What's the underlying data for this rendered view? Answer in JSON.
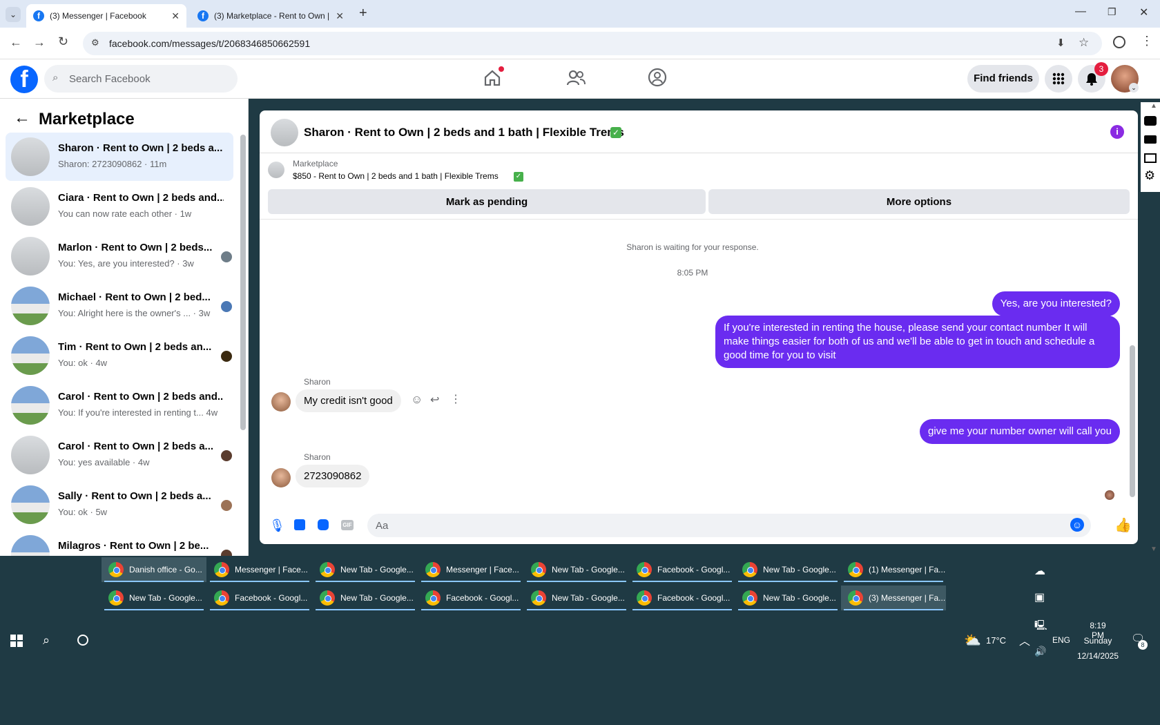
{
  "browser": {
    "tabs": [
      {
        "title": "(3) Messenger | Facebook",
        "active": true
      },
      {
        "title": "(3) Marketplace - Rent to Own |",
        "active": false
      }
    ],
    "new_tab": "+",
    "url": "facebook.com/messages/t/2068346850662591",
    "window_controls": [
      "minimize-icon",
      "restore-icon",
      "close-icon"
    ]
  },
  "facebook": {
    "search_placeholder": "Search Facebook",
    "find_friends": "Find friends",
    "notification_count": "3"
  },
  "sidebar": {
    "title": "Marketplace",
    "conversations": [
      {
        "title": "Sharon · Rent to Own | 2 beds a...",
        "sub": "Sharon: 2723090862 · 11m",
        "thumb": "room"
      },
      {
        "title": "Ciara · Rent to Own | 2 beds and...",
        "sub": "You can now rate each other · 1w",
        "thumb": "room"
      },
      {
        "title": "Marlon · Rent to Own | 2 beds...",
        "sub": "You: Yes, are you interested? · 3w",
        "thumb": "room"
      },
      {
        "title": "Michael · Rent to Own | 2 bed...",
        "sub": "You: Alright here is the owner's ... · 3w",
        "thumb": "house"
      },
      {
        "title": "Tim · Rent to Own | 2 beds an...",
        "sub": "You: ok · 4w",
        "thumb": "house"
      },
      {
        "title": "Carol · Rent to Own | 2 beds and...",
        "sub": "You: If you're interested in renting t... 4w",
        "thumb": "house"
      },
      {
        "title": "Carol · Rent to Own | 2 beds a...",
        "sub": "You: yes available · 4w",
        "thumb": "room"
      },
      {
        "title": "Sally · Rent to Own | 2 beds a...",
        "sub": "You: ok · 5w",
        "thumb": "house"
      },
      {
        "title": "Milagros · Rent to Own | 2 be...",
        "sub": "",
        "thumb": "house"
      }
    ]
  },
  "chat": {
    "header_title": "Sharon · Rent to Own | 2 beds and 1 bath | Flexible Trems",
    "listing_label": "Marketplace",
    "listing_title": "$850 - Rent to Own | 2 beds and 1 bath | Flexible Trems",
    "mark_pending": "Mark as pending",
    "more_options": "More options",
    "waiting_text": "Sharon is waiting for your response.",
    "timestamp": "8:05 PM",
    "messages": [
      {
        "from": "me",
        "text": "Yes, are you interested?"
      },
      {
        "from": "me",
        "text": "If you're interested in renting the house, please send your contact number It will make things easier for both of us and we'll be able to get in touch and schedule a good time for you to visit"
      },
      {
        "from": "Sharon",
        "text": "My credit isn't good"
      },
      {
        "from": "me",
        "text": "give me your number owner will call you"
      },
      {
        "from": "Sharon",
        "text": "2723090862"
      }
    ],
    "composer_placeholder": "Aa",
    "accent_color": "#6a2cf0"
  },
  "taskbar": {
    "row1": [
      "Danish office - Go...",
      "Messenger | Face...",
      "New Tab - Google...",
      "Messenger | Face...",
      "New Tab - Google...",
      "Facebook - Googl...",
      "New Tab - Google...",
      "(1) Messenger | Fa..."
    ],
    "row2": [
      "New Tab - Google...",
      "Facebook - Googl...",
      "New Tab - Google...",
      "Facebook - Googl...",
      "New Tab - Google...",
      "Facebook - Googl...",
      "New Tab - Google...",
      "(3) Messenger | Fa..."
    ],
    "weather": "17°C",
    "lang": "ENG",
    "time": "8:19 PM",
    "day": "Sunday",
    "date": "12/14/2025",
    "action_center_count": "8"
  }
}
